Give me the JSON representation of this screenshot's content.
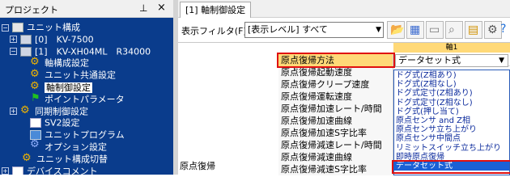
{
  "project_pane": {
    "title": "プロジェクト",
    "pin_icon": "pin-icon",
    "close_icon": "close-icon",
    "tree": [
      {
        "label": "ユニット構成",
        "icon": "folder-icon",
        "expander": "−"
      },
      {
        "label": "[0]　KV-7500",
        "icon": "plc-icon",
        "expander": "+"
      },
      {
        "label": "[1]　KV-XH04ML　R34000",
        "icon": "plc-icon",
        "expander": "−"
      },
      {
        "label": "軸構成設定",
        "icon": "gear-icon"
      },
      {
        "label": "ユニット共通設定",
        "icon": "gear-icon"
      },
      {
        "label": "軸制御設定",
        "icon": "gear-icon",
        "selected": true
      },
      {
        "label": "ポイントパラメータ",
        "icon": "flag-icon"
      },
      {
        "label": "同期制御設定",
        "icon": "gear-icon",
        "expander": "+"
      },
      {
        "label": "SV2設定",
        "icon": "doc-icon"
      },
      {
        "label": "ユニットプログラム",
        "icon": "program-icon"
      },
      {
        "label": "オプション設定",
        "icon": "option-icon"
      },
      {
        "label": "ユニット構成切替",
        "icon": "gear-icon"
      },
      {
        "label": "デバイスコメント",
        "icon": "doc-icon",
        "expander": "+"
      }
    ]
  },
  "main": {
    "tab_label": "[1] 軸制御設定",
    "filter": {
      "label": "表示フィルタ(F)",
      "value": "[表示レベル] すべて"
    },
    "toolbar_icons": [
      "open-folder-icon",
      "export-icon",
      "calc-icon",
      "search-icon",
      "import-icon",
      "settings-icon",
      "help-icon"
    ],
    "axis_header": "軸1",
    "group_label": "原点復帰",
    "rows": [
      {
        "name": "原点復帰方法",
        "value": "データセット式"
      },
      {
        "name": "原点復帰起動速度",
        "value": ""
      },
      {
        "name": "原点復帰クリープ速度",
        "value": ""
      },
      {
        "name": "原点復帰運転速度",
        "value": ""
      },
      {
        "name": "原点復帰加速レート/時間",
        "value": ""
      },
      {
        "name": "原点復帰加速曲線",
        "value": ""
      },
      {
        "name": "原点復帰加速S字比率",
        "value": ""
      },
      {
        "name": "原点復帰減速レート/時間",
        "value": ""
      },
      {
        "name": "原点復帰減速曲線",
        "value": ""
      },
      {
        "name": "原点復帰減速S字比率",
        "value": ""
      }
    ],
    "dropdown_options": [
      "ドグ式(Z相あり)",
      "ドグ式(Z相なし)",
      "ドグ式定寸(Z相あり)",
      "ドグ式定寸(Z相なし)",
      "ドグ式(押し当て)",
      "原点センサ and Z相",
      "原点センサ立ち上がり",
      "原点センサ中間点",
      "リミットスイッチ立ち上がり",
      "即時原点復帰",
      "データセット式"
    ],
    "dropdown_selected_index": 10
  }
}
